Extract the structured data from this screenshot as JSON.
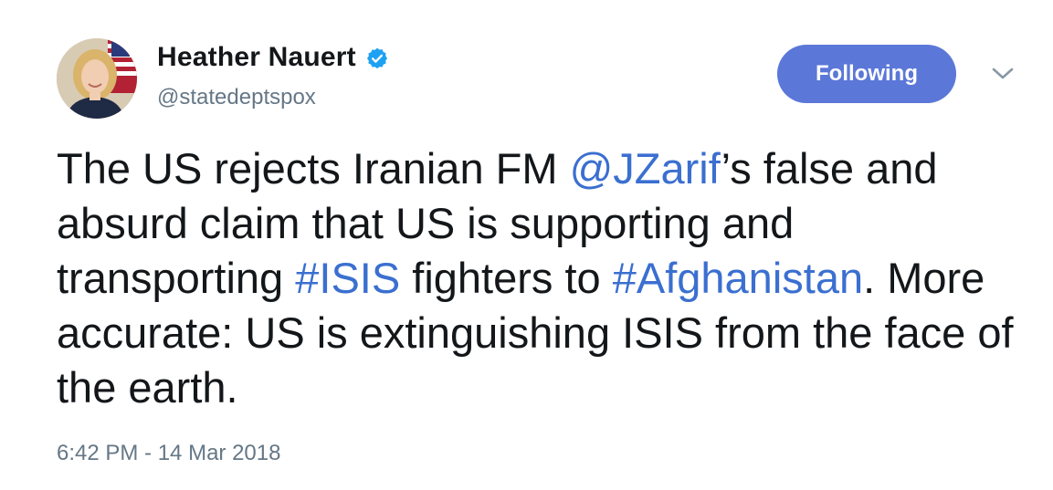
{
  "author": {
    "display_name": "Heather Nauert",
    "handle": "@statedeptspox",
    "verified": true
  },
  "follow_button": {
    "label": "Following"
  },
  "tweet": {
    "segments": {
      "s1": "The US rejects Iranian FM ",
      "mention_jzarif": "@JZarif",
      "s2": "’s false and absurd claim that US is supporting and transporting ",
      "hashtag_isis": "#ISIS",
      "s3": " fighters to ",
      "hashtag_afghanistan": "#Afghanistan",
      "s4": ". More accurate: US is extinguishing ISIS from the face of the earth."
    },
    "timestamp": "6:42 PM - 14 Mar 2018"
  },
  "colors": {
    "link": "#3b6fd0",
    "button": "#5b77d8",
    "secondary_text": "#657786",
    "verified": "#1da1f2"
  },
  "icons": {
    "verified": "verified-badge-icon",
    "menu": "chevron-down-icon"
  }
}
